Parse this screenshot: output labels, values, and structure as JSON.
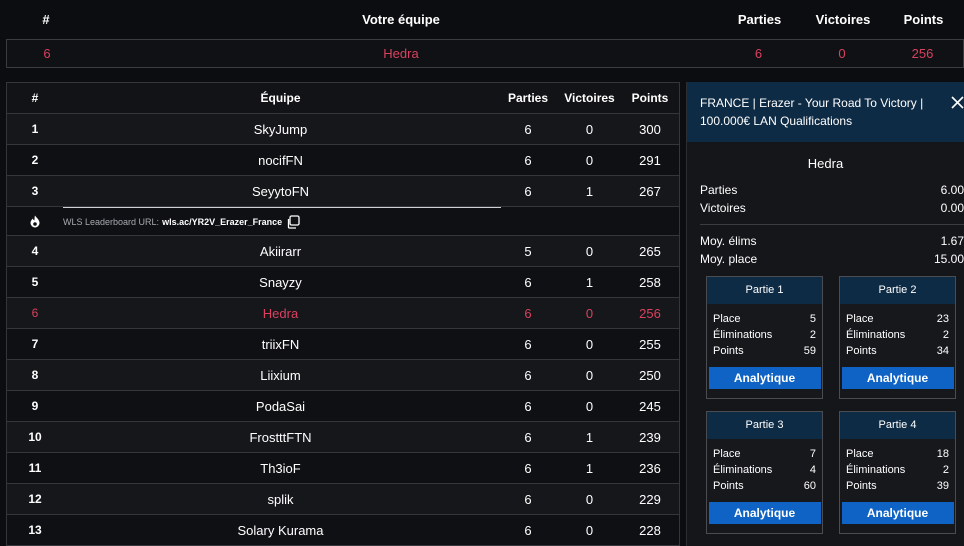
{
  "your_team": {
    "headers": {
      "rank": "#",
      "team": "Votre équipe",
      "parties": "Parties",
      "victoires": "Victoires",
      "points": "Points"
    },
    "row": {
      "rank": "6",
      "team": "Hedra",
      "parties": "6",
      "victoires": "0",
      "points": "256"
    }
  },
  "leaderboard": {
    "headers": {
      "rank": "#",
      "team": "Équipe",
      "parties": "Parties",
      "victoires": "Victoires",
      "points": "Points"
    },
    "rows": [
      {
        "rank": "1",
        "team": "SkyJump",
        "parties": "6",
        "victoires": "0",
        "points": "300"
      },
      {
        "rank": "2",
        "team": "nocifFN",
        "parties": "6",
        "victoires": "0",
        "points": "291"
      },
      {
        "rank": "3",
        "team": "SeyytoFN",
        "parties": "6",
        "victoires": "1",
        "points": "267"
      },
      {
        "rank": "4",
        "team": "Akiirarr",
        "parties": "5",
        "victoires": "0",
        "points": "265"
      },
      {
        "rank": "5",
        "team": "Snayzy",
        "parties": "6",
        "victoires": "1",
        "points": "258"
      },
      {
        "rank": "6",
        "team": "Hedra",
        "parties": "6",
        "victoires": "0",
        "points": "256"
      },
      {
        "rank": "7",
        "team": "triixFN",
        "parties": "6",
        "victoires": "0",
        "points": "255"
      },
      {
        "rank": "8",
        "team": "Liixium",
        "parties": "6",
        "victoires": "0",
        "points": "250"
      },
      {
        "rank": "9",
        "team": "PodaSai",
        "parties": "6",
        "victoires": "0",
        "points": "245"
      },
      {
        "rank": "10",
        "team": "FrostttFTN",
        "parties": "6",
        "victoires": "1",
        "points": "239"
      },
      {
        "rank": "11",
        "team": "Th3ioF",
        "parties": "6",
        "victoires": "1",
        "points": "236"
      },
      {
        "rank": "12",
        "team": "splik",
        "parties": "6",
        "victoires": "0",
        "points": "229"
      },
      {
        "rank": "13",
        "team": "Solary Kurama",
        "parties": "6",
        "victoires": "0",
        "points": "228"
      }
    ],
    "wls": {
      "label": "WLS Leaderboard URL:",
      "url": "wls.ac/YR2V_Erazer_France",
      "icon": "fire-icon"
    }
  },
  "panel": {
    "title": "FRANCE | Erazer - Your Road To Victory | 100.000€ LAN Qualifications",
    "team": "Hedra",
    "stats": [
      {
        "label": "Parties",
        "value": "6.00"
      },
      {
        "label": "Victoires",
        "value": "0.00"
      }
    ],
    "stats2": [
      {
        "label": "Moy. élims",
        "value": "1.67"
      },
      {
        "label": "Moy. place",
        "value": "15.00"
      }
    ],
    "games": [
      {
        "title": "Partie 1",
        "place_label": "Place",
        "place": "5",
        "elim_label": "Éliminations",
        "elims": "2",
        "points_label": "Points",
        "points": "59",
        "button": "Analytique"
      },
      {
        "title": "Partie 2",
        "place_label": "Place",
        "place": "23",
        "elim_label": "Éliminations",
        "elims": "2",
        "points_label": "Points",
        "points": "34",
        "button": "Analytique"
      },
      {
        "title": "Partie 3",
        "place_label": "Place",
        "place": "7",
        "elim_label": "Éliminations",
        "elims": "4",
        "points_label": "Points",
        "points": "60",
        "button": "Analytique"
      },
      {
        "title": "Partie 4",
        "place_label": "Place",
        "place": "18",
        "elim_label": "Éliminations",
        "elims": "2",
        "points_label": "Points",
        "points": "39",
        "button": "Analytique"
      }
    ]
  },
  "colors": {
    "highlight": "#d9415f",
    "accent_blue": "#0f63c4",
    "header_navy": "#0e2b45"
  }
}
